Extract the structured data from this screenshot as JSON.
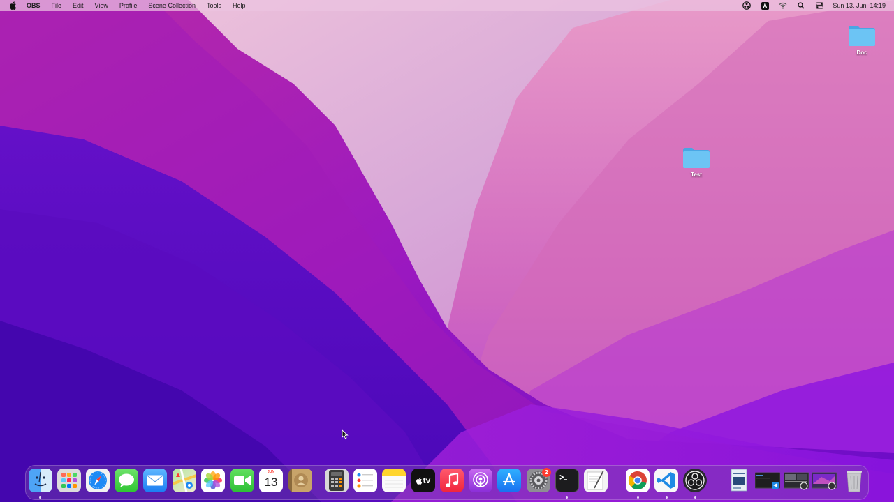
{
  "menubar": {
    "apple_icon": "apple-icon",
    "app_name": "OBS",
    "menus": [
      "File",
      "Edit",
      "View",
      "Profile",
      "Scene Collection",
      "Tools",
      "Help"
    ],
    "status_icons": [
      "obs-status-icon",
      "input-source-icon",
      "wifi-icon",
      "search-icon",
      "control-center-icon"
    ],
    "input_source_letter": "A",
    "clock": {
      "date": "Sun 13. Jun",
      "time": "14:19"
    }
  },
  "desktop": {
    "icons": [
      {
        "label": "Doc",
        "icon": "folder-icon"
      },
      {
        "label": "Test",
        "icon": "folder-icon"
      }
    ]
  },
  "dock": {
    "calendar": {
      "month": "JUN",
      "day": "13"
    },
    "system_preferences_badge": "2",
    "tv_label": "tv",
    "apps": [
      "Finder",
      "Launchpad",
      "Safari",
      "Messages",
      "Mail",
      "Maps",
      "Photos",
      "FaceTime",
      "Calendar",
      "Contacts",
      "Calculator",
      "Reminders",
      "Notes",
      "TV",
      "Music",
      "Podcasts",
      "App Store",
      "System Preferences",
      "Terminal",
      "TextEdit",
      "Google Chrome",
      "Visual Studio Code",
      "OBS"
    ]
  },
  "colors": {
    "menubar_bg": "#ecc4e0",
    "folder_blue": "#6cc4f4",
    "badge_red": "#ff3b30"
  }
}
